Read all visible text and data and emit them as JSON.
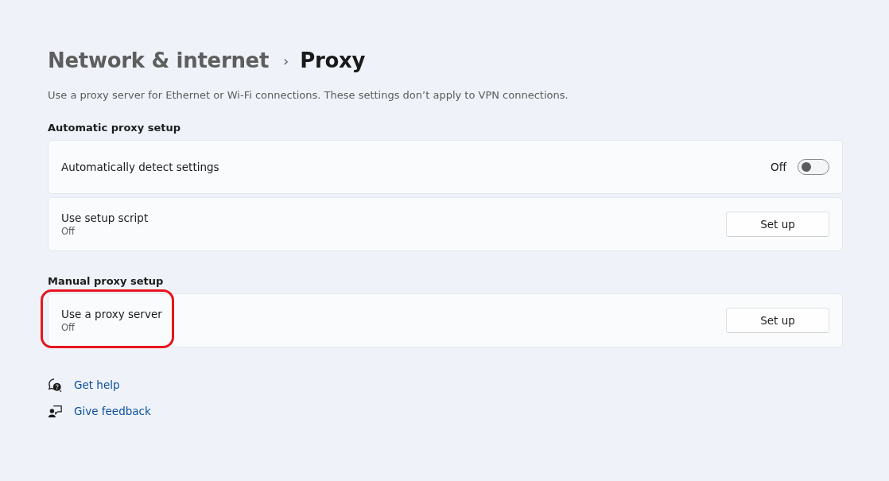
{
  "breadcrumb": {
    "parent": "Network & internet",
    "separator": "›",
    "current": "Proxy"
  },
  "description": "Use a proxy server for Ethernet or Wi-Fi connections. These settings don’t apply to VPN connections.",
  "sections": [
    {
      "heading": "Automatic proxy setup",
      "rows": [
        {
          "kind": "toggle",
          "title": "Automatically detect settings",
          "state_label": "Off",
          "on": false,
          "highlighted": false
        },
        {
          "kind": "button",
          "title": "Use setup script",
          "subtitle": "Off",
          "button": "Set up",
          "highlighted": false
        }
      ]
    },
    {
      "heading": "Manual proxy setup",
      "rows": [
        {
          "kind": "button",
          "title": "Use a proxy server",
          "subtitle": "Off",
          "button": "Set up",
          "highlighted": true
        }
      ]
    }
  ],
  "links": [
    {
      "kind": "help",
      "label": "Get help"
    },
    {
      "kind": "feedback",
      "label": "Give feedback"
    }
  ]
}
